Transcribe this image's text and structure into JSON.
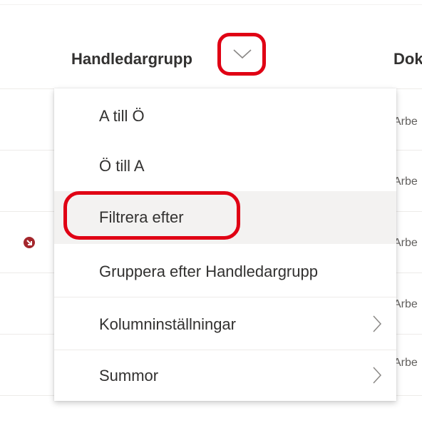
{
  "header": {
    "column_title": "Handledargrupp",
    "next_column_title": "Dok"
  },
  "rows": [
    {
      "cell": "Arbe"
    },
    {
      "cell": "Arbe"
    },
    {
      "cell": "Arbe"
    },
    {
      "cell": "Arbe"
    },
    {
      "cell": "Arbe"
    }
  ],
  "menu": {
    "items": [
      {
        "label": "A till Ö"
      },
      {
        "label": "Ö till A"
      },
      {
        "label": "Filtrera efter",
        "highlighted": true
      },
      {
        "label": "Gruppera efter Handledargrupp"
      },
      {
        "label": "Kolumninställningar",
        "submenu": true
      },
      {
        "label": "Summor",
        "submenu": true
      }
    ]
  },
  "colors": {
    "annotation_red": "#e00014",
    "hover_bg": "#f3f2f1",
    "status_icon": "#a4262c"
  },
  "icons": {
    "header_chevron": "chevron-down-icon",
    "submenu_chevron": "chevron-right-icon",
    "row_status": "arrow-down-right-circle-icon"
  }
}
